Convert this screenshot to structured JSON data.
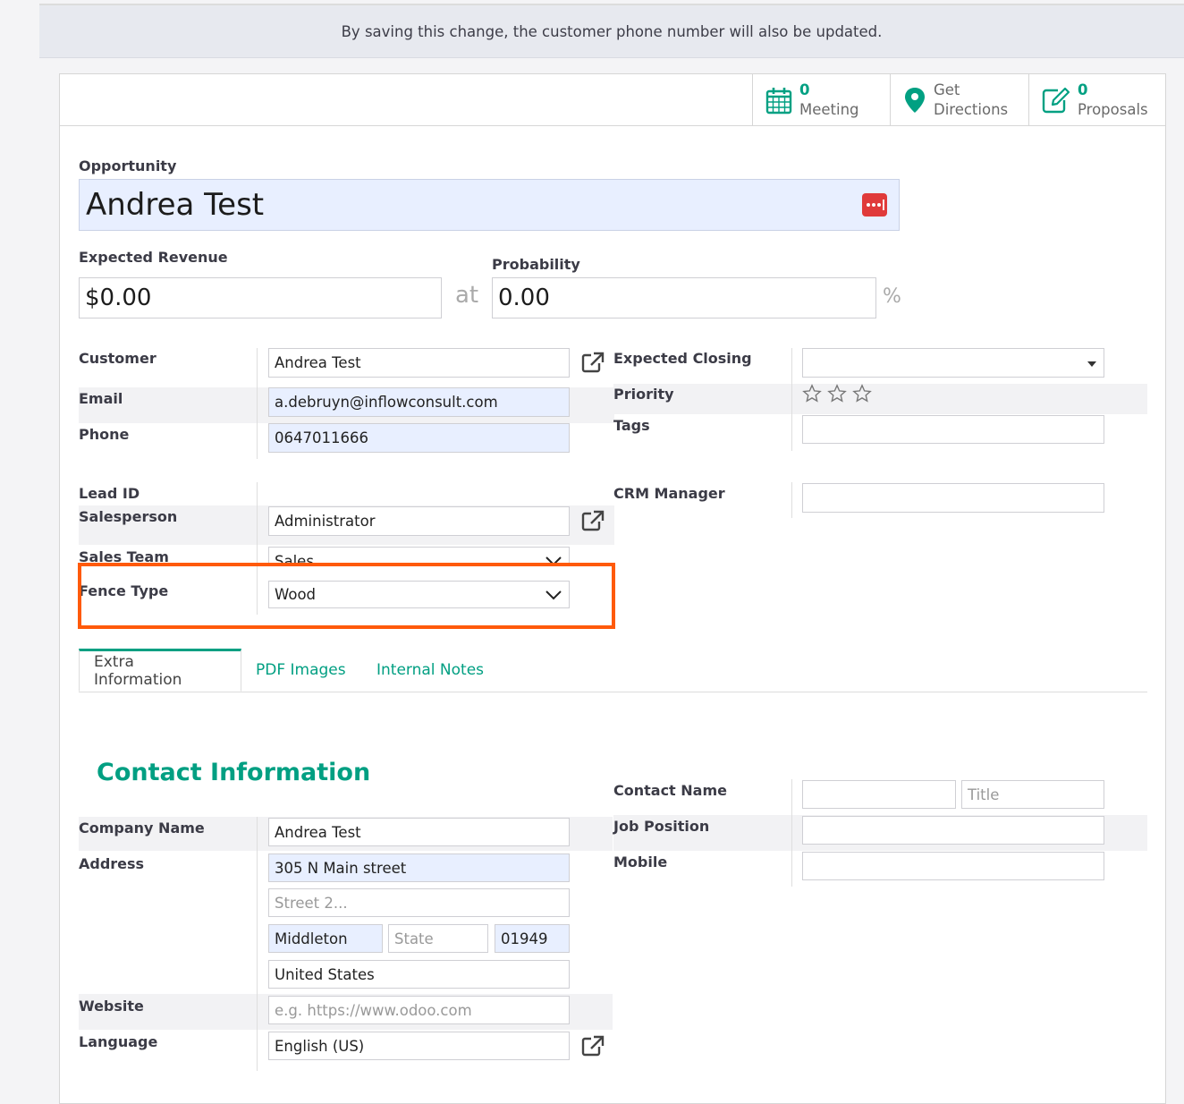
{
  "banner": "By saving this change, the customer phone number will also be updated.",
  "stat_buttons": {
    "meeting": {
      "count": "0",
      "label": "Meeting"
    },
    "directions": {
      "line1": "Get",
      "line2": "Directions"
    },
    "proposals": {
      "count": "0",
      "label": "Proposals"
    }
  },
  "opportunity": {
    "label": "Opportunity",
    "value": "Andrea Test"
  },
  "revenue": {
    "label": "Expected Revenue",
    "value": "$0.00",
    "at": "at"
  },
  "probability": {
    "label": "Probability",
    "value": "0.00",
    "unit": "%"
  },
  "left_fields": {
    "customer": {
      "label": "Customer",
      "value": "Andrea Test"
    },
    "email": {
      "label": "Email",
      "value": "a.debruyn@inflowconsult.com"
    },
    "phone": {
      "label": "Phone",
      "value": "0647011666"
    },
    "lead_id": {
      "label": "Lead ID"
    },
    "salesperson": {
      "label": "Salesperson",
      "value": "Administrator"
    },
    "sales_team": {
      "label": "Sales Team",
      "value": "Sales"
    },
    "fence_type": {
      "label": "Fence Type",
      "value": "Wood"
    }
  },
  "right_fields": {
    "expected_closing": {
      "label": "Expected Closing",
      "value": ""
    },
    "priority": {
      "label": "Priority",
      "stars": 0
    },
    "tags": {
      "label": "Tags",
      "value": ""
    },
    "crm_manager": {
      "label": "CRM Manager",
      "value": ""
    }
  },
  "tabs": [
    "Extra Information",
    "PDF Images",
    "Internal Notes"
  ],
  "contact": {
    "title": "Contact Information",
    "company_name": {
      "label": "Company Name",
      "value": "Andrea Test"
    },
    "address": {
      "label": "Address",
      "street": "305 N Main street",
      "street2_placeholder": "Street 2...",
      "city": "Middleton",
      "state_placeholder": "State",
      "zip": "01949",
      "country": "United States"
    },
    "website": {
      "label": "Website",
      "placeholder": "e.g. https://www.odoo.com"
    },
    "language": {
      "label": "Language",
      "value": "English (US)"
    },
    "contact_name": {
      "label": "Contact Name",
      "value": "",
      "title_placeholder": "Title"
    },
    "job_position": {
      "label": "Job Position",
      "value": ""
    },
    "mobile": {
      "label": "Mobile",
      "value": ""
    }
  },
  "colors": {
    "accent": "#01a082",
    "highlight_box": "#ff5a0a",
    "field_highlight": "#e8efff"
  }
}
